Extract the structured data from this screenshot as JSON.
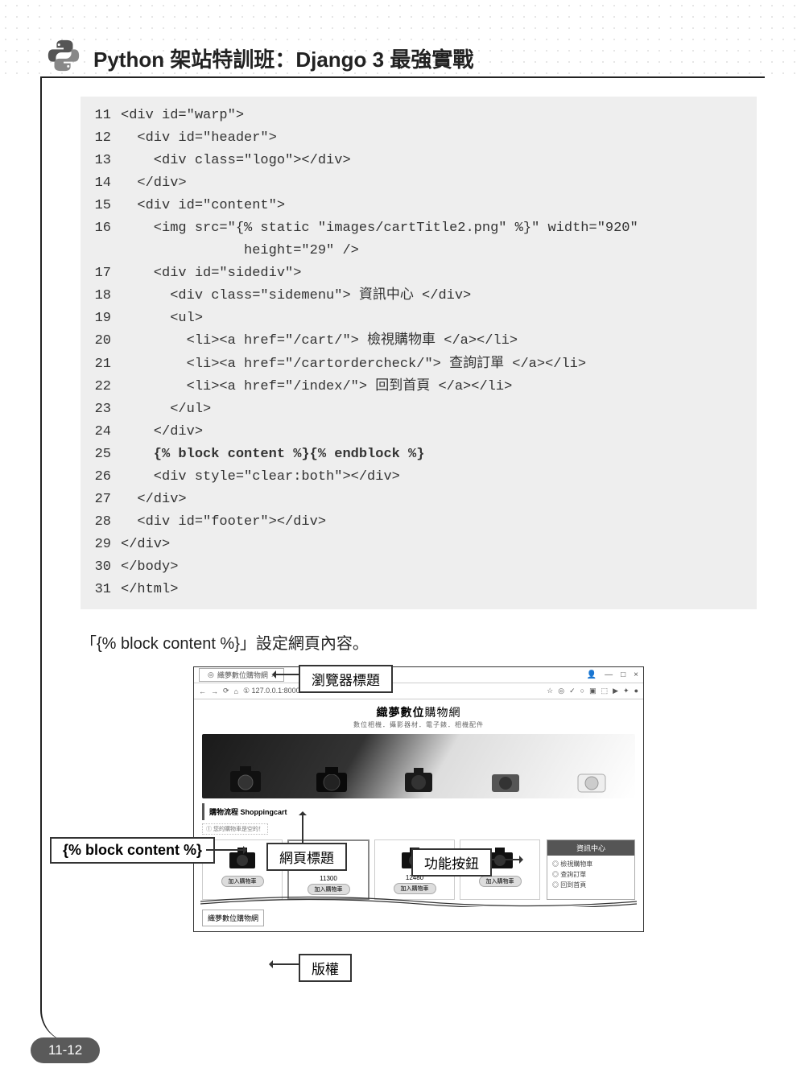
{
  "header": {
    "title": "Python 架站特訓班：Django 3 最強實戰"
  },
  "code": {
    "lines": [
      {
        "n": "11",
        "t": "<div id=\"warp\">"
      },
      {
        "n": "12",
        "t": "  <div id=\"header\">"
      },
      {
        "n": "13",
        "t": "    <div class=\"logo\"></div>"
      },
      {
        "n": "14",
        "t": "  </div>"
      },
      {
        "n": "15",
        "t": "  <div id=\"content\">"
      },
      {
        "n": "16",
        "t": "    <img src=\"{% static \"images/cartTitle2.png\" %}\" width=\"920\"\n               height=\"29\" />"
      },
      {
        "n": "17",
        "t": "    <div id=\"sidediv\">"
      },
      {
        "n": "18",
        "t": "      <div class=\"sidemenu\"> 資訊中心 </div>"
      },
      {
        "n": "19",
        "t": "      <ul>"
      },
      {
        "n": "20",
        "t": "        <li><a href=\"/cart/\"> 檢視購物車 </a></li>"
      },
      {
        "n": "21",
        "t": "        <li><a href=\"/cartordercheck/\"> 查詢訂單 </a></li>"
      },
      {
        "n": "22",
        "t": "        <li><a href=\"/index/\"> 回到首頁 </a></li>"
      },
      {
        "n": "23",
        "t": "      </ul>"
      },
      {
        "n": "24",
        "t": "    </div>"
      },
      {
        "n": "25",
        "t": "    {% block content %}{% endblock %}",
        "bold": true
      },
      {
        "n": "26",
        "t": "    <div style=\"clear:both\"></div>"
      },
      {
        "n": "27",
        "t": "  </div>"
      },
      {
        "n": "28",
        "t": "  <div id=\"footer\"></div>"
      },
      {
        "n": "29",
        "t": "</div>"
      },
      {
        "n": "30",
        "t": "</body>"
      },
      {
        "n": "31",
        "t": "</html>"
      }
    ]
  },
  "paragraph": "「{% block content %}」設定網頁內容。",
  "screenshot": {
    "tab": "織夢數位購物網",
    "url": "① 127.0.0.1:8000",
    "site_title_main": "織夢數位",
    "site_title_sub": "購物網",
    "site_tagline": "數位相機．攝影器材．電子錶．相機配件",
    "flow": "購物流程 Shoppingcart",
    "notice": "① 您的購物車是空的！",
    "products": [
      {
        "price": "",
        "btn": "加入購物車"
      },
      {
        "price": "11300",
        "btn": "加入購物車"
      },
      {
        "price": "12480",
        "btn": "加入購物車"
      },
      {
        "price": "",
        "btn": "加入購物車"
      }
    ],
    "side_title": "資訊中心",
    "side_items": [
      "檢視購物車",
      "查詢訂單",
      "回到首頁"
    ],
    "footer": "織夢數位購物網"
  },
  "callouts": {
    "browser": "瀏覽器標題",
    "webtitle": "網頁標題",
    "func": "功能按鈕",
    "block": "{% block content %}",
    "footer": "版權"
  },
  "page_num": "11-12"
}
